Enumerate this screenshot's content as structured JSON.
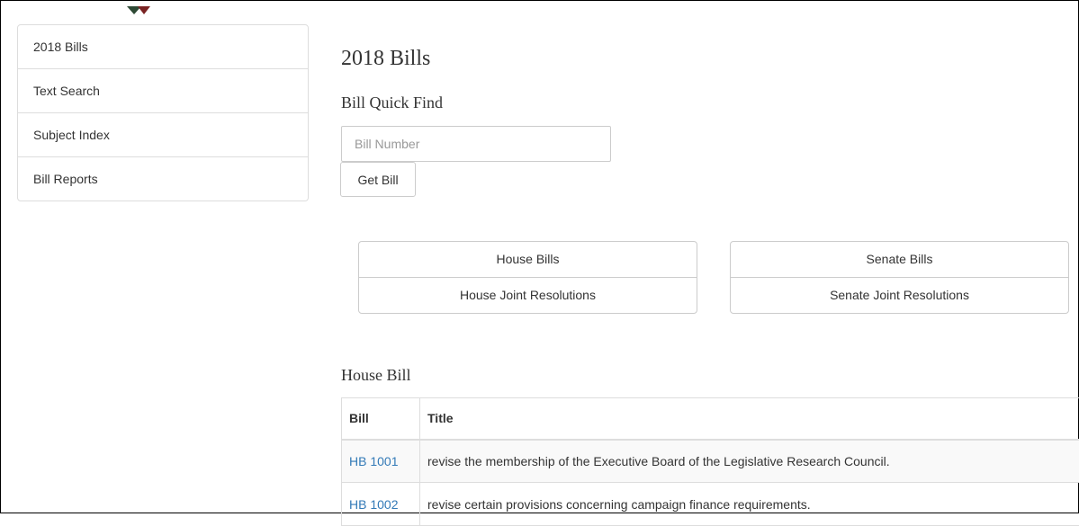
{
  "sidebar": {
    "items": [
      {
        "label": "2018 Bills"
      },
      {
        "label": "Text Search"
      },
      {
        "label": "Subject Index"
      },
      {
        "label": "Bill Reports"
      }
    ]
  },
  "main": {
    "title": "2018 Bills",
    "quick_find": {
      "title": "Bill Quick Find",
      "input_placeholder": "Bill Number",
      "input_value": "",
      "button_label": "Get Bill"
    },
    "house_group": {
      "bills_label": "House Bills",
      "resolutions_label": "House Joint Resolutions"
    },
    "senate_group": {
      "bills_label": "Senate Bills",
      "resolutions_label": "Senate Joint Resolutions"
    },
    "section_title": "House Bill",
    "table": {
      "headers": [
        "Bill",
        "Title"
      ],
      "rows": [
        {
          "bill": "HB 1001",
          "title": "revise the membership of the Executive Board of the Legislative Research Council."
        },
        {
          "bill": "HB 1002",
          "title": "revise certain provisions concerning campaign finance requirements."
        }
      ]
    }
  },
  "colors": {
    "link": "#337ab7",
    "border": "#dddddd",
    "text": "#333333",
    "marker_green": "#2e4a35",
    "marker_red": "#7a2323"
  }
}
